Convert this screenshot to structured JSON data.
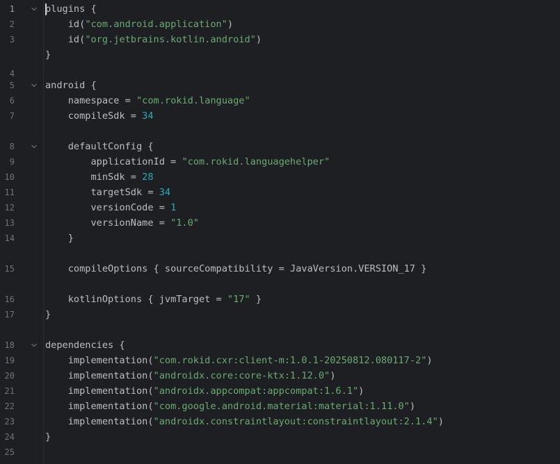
{
  "editor": {
    "lines": [
      {
        "no": "1",
        "indent": "",
        "fold": true,
        "segments": [
          {
            "t": "plugins {",
            "k": "plain"
          }
        ]
      },
      {
        "no": "2",
        "indent": "    ",
        "fold": false,
        "segments": [
          {
            "t": "id(",
            "k": "plain"
          },
          {
            "t": "\"com.android.application\"",
            "k": "str"
          },
          {
            "t": ")",
            "k": "plain"
          }
        ]
      },
      {
        "no": "3",
        "indent": "    ",
        "fold": false,
        "segments": [
          {
            "t": "id(",
            "k": "plain"
          },
          {
            "t": "\"org.jetbrains.kotlin.android\"",
            "k": "str"
          },
          {
            "t": ")",
            "k": "plain"
          }
        ]
      },
      {
        "no": "",
        "indent": "",
        "fold": false,
        "segments": [
          {
            "t": "}",
            "k": "plain"
          }
        ]
      },
      {
        "no": "4",
        "indent": "",
        "fold": false,
        "segments": []
      },
      {
        "no": "5",
        "indent": "",
        "fold": true,
        "segments": [
          {
            "t": "android {",
            "k": "plain"
          }
        ]
      },
      {
        "no": "6",
        "indent": "    ",
        "fold": false,
        "segments": [
          {
            "t": "namespace = ",
            "k": "plain"
          },
          {
            "t": "\"com.rokid.language\"",
            "k": "str"
          }
        ]
      },
      {
        "no": "7",
        "indent": "    ",
        "fold": false,
        "segments": [
          {
            "t": "compileSdk = ",
            "k": "plain"
          },
          {
            "t": "34",
            "k": "num"
          }
        ]
      },
      {
        "no": "",
        "indent": "",
        "fold": false,
        "segments": []
      },
      {
        "no": "8",
        "indent": "    ",
        "fold": true,
        "segments": [
          {
            "t": "defaultConfig {",
            "k": "plain"
          }
        ]
      },
      {
        "no": "9",
        "indent": "        ",
        "fold": false,
        "segments": [
          {
            "t": "applicationId = ",
            "k": "plain"
          },
          {
            "t": "\"com.rokid.languagehelper\"",
            "k": "str"
          }
        ]
      },
      {
        "no": "10",
        "indent": "        ",
        "fold": false,
        "segments": [
          {
            "t": "minSdk = ",
            "k": "plain"
          },
          {
            "t": "28",
            "k": "num"
          }
        ]
      },
      {
        "no": "11",
        "indent": "        ",
        "fold": false,
        "segments": [
          {
            "t": "targetSdk = ",
            "k": "plain"
          },
          {
            "t": "34",
            "k": "num"
          }
        ]
      },
      {
        "no": "12",
        "indent": "        ",
        "fold": false,
        "segments": [
          {
            "t": "versionCode = ",
            "k": "plain"
          },
          {
            "t": "1",
            "k": "num"
          }
        ]
      },
      {
        "no": "13",
        "indent": "        ",
        "fold": false,
        "segments": [
          {
            "t": "versionName = ",
            "k": "plain"
          },
          {
            "t": "\"1.0\"",
            "k": "str"
          }
        ]
      },
      {
        "no": "14",
        "indent": "    ",
        "fold": false,
        "segments": [
          {
            "t": "}",
            "k": "plain"
          }
        ]
      },
      {
        "no": "",
        "indent": "",
        "fold": false,
        "segments": []
      },
      {
        "no": "15",
        "indent": "    ",
        "fold": false,
        "segments": [
          {
            "t": "compileOptions { sourceCompatibility = JavaVersion.VERSION_17 }",
            "k": "plain"
          }
        ]
      },
      {
        "no": "",
        "indent": "",
        "fold": false,
        "segments": []
      },
      {
        "no": "16",
        "indent": "    ",
        "fold": false,
        "segments": [
          {
            "t": "kotlinOptions { jvmTarget = ",
            "k": "plain"
          },
          {
            "t": "\"17\"",
            "k": "str"
          },
          {
            "t": " }",
            "k": "plain"
          }
        ]
      },
      {
        "no": "17",
        "indent": "",
        "fold": false,
        "segments": [
          {
            "t": "}",
            "k": "plain"
          }
        ]
      },
      {
        "no": "",
        "indent": "",
        "fold": false,
        "segments": []
      },
      {
        "no": "18",
        "indent": "",
        "fold": true,
        "segments": [
          {
            "t": "dependencies {",
            "k": "plain"
          }
        ]
      },
      {
        "no": "19",
        "indent": "    ",
        "fold": false,
        "segments": [
          {
            "t": "implementation(",
            "k": "plain"
          },
          {
            "t": "\"com.rokid.cxr:client-m:1.0.1-20250812.080117-2\"",
            "k": "str"
          },
          {
            "t": ")",
            "k": "plain"
          }
        ]
      },
      {
        "no": "20",
        "indent": "    ",
        "fold": false,
        "segments": [
          {
            "t": "implementation(",
            "k": "plain"
          },
          {
            "t": "\"androidx.core:core-ktx:1.12.0\"",
            "k": "str"
          },
          {
            "t": ")",
            "k": "plain"
          }
        ]
      },
      {
        "no": "21",
        "indent": "    ",
        "fold": false,
        "segments": [
          {
            "t": "implementation(",
            "k": "plain"
          },
          {
            "t": "\"androidx.appcompat:appcompat:1.6.1\"",
            "k": "str"
          },
          {
            "t": ")",
            "k": "plain"
          }
        ]
      },
      {
        "no": "22",
        "indent": "    ",
        "fold": false,
        "segments": [
          {
            "t": "implementation(",
            "k": "plain"
          },
          {
            "t": "\"com.google.android.material:material:1.11.0\"",
            "k": "str"
          },
          {
            "t": ")",
            "k": "plain"
          }
        ]
      },
      {
        "no": "23",
        "indent": "    ",
        "fold": false,
        "segments": [
          {
            "t": "implementation(",
            "k": "plain"
          },
          {
            "t": "\"androidx.constraintlayout:constraintlayout:2.1.4\"",
            "k": "str"
          },
          {
            "t": ")",
            "k": "plain"
          }
        ]
      },
      {
        "no": "24",
        "indent": "",
        "fold": false,
        "segments": [
          {
            "t": "}",
            "k": "plain"
          }
        ]
      },
      {
        "no": "25",
        "indent": "",
        "fold": false,
        "segments": []
      }
    ]
  },
  "colors": {
    "background": "#1e1f22",
    "text": "#bcbec4",
    "string": "#6aab73",
    "number": "#2aacb8",
    "line_number": "#6f737a"
  }
}
